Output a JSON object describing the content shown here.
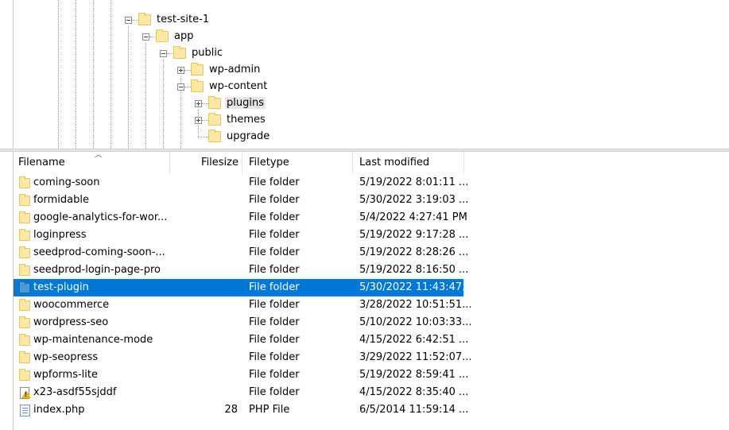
{
  "tree": {
    "nodes": [
      {
        "label": "test-site-1",
        "expander": "minus"
      },
      {
        "label": "app",
        "expander": "minus"
      },
      {
        "label": "public",
        "expander": "minus"
      },
      {
        "label": "wp-admin",
        "expander": "plus"
      },
      {
        "label": "wp-content",
        "expander": "minus"
      },
      {
        "label": "plugins",
        "expander": "plus",
        "highlighted": true
      },
      {
        "label": "themes",
        "expander": "plus"
      },
      {
        "label": "upgrade",
        "expander": "none"
      }
    ]
  },
  "list": {
    "columns": {
      "filename": "Filename",
      "filesize": "Filesize",
      "filetype": "Filetype",
      "last_modified": "Last modified"
    },
    "sort_indicator": "^",
    "rows": [
      {
        "icon": "folder-icon",
        "name": "coming-soon",
        "size": "",
        "type": "File folder",
        "modified": "5/19/2022 8:01:11 ..."
      },
      {
        "icon": "folder-icon",
        "name": "formidable",
        "size": "",
        "type": "File folder",
        "modified": "5/30/2022 3:19:03 ..."
      },
      {
        "icon": "folder-icon",
        "name": "google-analytics-for-wor...",
        "size": "",
        "type": "File folder",
        "modified": "5/4/2022 4:27:41 PM"
      },
      {
        "icon": "folder-icon",
        "name": "loginpress",
        "size": "",
        "type": "File folder",
        "modified": "5/19/2022 9:17:28 ..."
      },
      {
        "icon": "folder-icon",
        "name": "seedprod-coming-soon-...",
        "size": "",
        "type": "File folder",
        "modified": "5/19/2022 8:28:26 ..."
      },
      {
        "icon": "folder-icon",
        "name": "seedprod-login-page-pro",
        "size": "",
        "type": "File folder",
        "modified": "5/19/2022 8:16:50 ..."
      },
      {
        "icon": "folder-icon",
        "name": "test-plugin",
        "size": "",
        "type": "File folder",
        "modified": "5/30/2022 11:43:47...",
        "selected": true
      },
      {
        "icon": "folder-icon",
        "name": "woocommerce",
        "size": "",
        "type": "File folder",
        "modified": "3/28/2022 10:51:51..."
      },
      {
        "icon": "folder-icon",
        "name": "wordpress-seo",
        "size": "",
        "type": "File folder",
        "modified": "5/10/2022 10:03:33..."
      },
      {
        "icon": "folder-icon",
        "name": "wp-maintenance-mode",
        "size": "",
        "type": "File folder",
        "modified": "4/15/2022 6:42:51 ..."
      },
      {
        "icon": "folder-icon",
        "name": "wp-seopress",
        "size": "",
        "type": "File folder",
        "modified": "3/29/2022 11:52:07..."
      },
      {
        "icon": "folder-icon",
        "name": "wpforms-lite",
        "size": "",
        "type": "File folder",
        "modified": "5/19/2022 8:59:41 ..."
      },
      {
        "icon": "warning-file-icon",
        "name": "x23-asdf55sjddf",
        "size": "",
        "type": "File folder",
        "modified": "4/15/2022 8:35:40 ..."
      },
      {
        "icon": "php-file-icon",
        "name": "index.php",
        "size": "28",
        "type": "PHP File",
        "modified": "6/5/2014 11:59:14 ..."
      }
    ]
  },
  "colors": {
    "selection": "#0078d7",
    "folder_fill": "#fde9a6",
    "folder_border": "#e8c45c",
    "tree_highlight": "#e6e6e6"
  }
}
